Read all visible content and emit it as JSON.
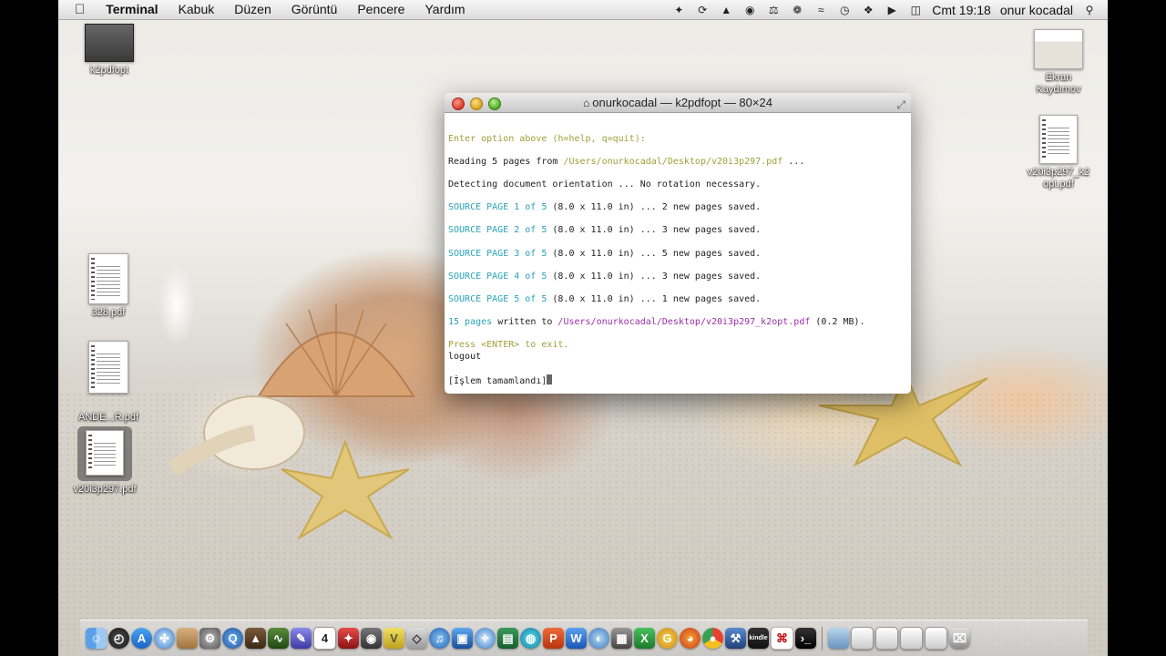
{
  "menubar": {
    "app_name": "Terminal",
    "items": [
      "Kabuk",
      "Düzen",
      "Görüntü",
      "Pencere",
      "Yardım"
    ],
    "clock": "Cmt 19:18",
    "user": "onur kocadal",
    "tray_icons": [
      "dropbox-icon",
      "sync-icon",
      "hat-icon",
      "disk-icon",
      "bank-icon",
      "gift-icon",
      "wifi-icon",
      "time-machine-icon",
      "bluetooth-icon",
      "volume-icon",
      "battery-icon"
    ]
  },
  "desktop_icons": {
    "k2pdfopt": "k2pdfopt",
    "ekran": "Ekran\nKaydımov",
    "v20_k2opt": "v20i3p297_k2\nopt.pdf",
    "pdf328": "328.pdf",
    "ande": "ANDE...R.pdf",
    "v20": "v20i3p297.pdf"
  },
  "terminal": {
    "title": "onurkocadal — k2pdfopt — 80×24",
    "lines": {
      "prompt": "Enter option above (h=help, q=quit):",
      "reading_pre": "Reading 5 pages from ",
      "reading_path": "/Users/onurkocadal/Desktop/v20i3p297.pdf",
      "reading_post": " ...",
      "detecting": "Detecting document orientation ... No rotation necessary.",
      "src1_a": "SOURCE PAGE 1 of 5",
      "src1_b": " (8.0 x 11.0 in) ... 2 new pages saved.",
      "src2_a": "SOURCE PAGE 2 of 5",
      "src2_b": " (8.0 x 11.0 in) ... 3 new pages saved.",
      "src3_a": "SOURCE PAGE 3 of 5",
      "src3_b": " (8.0 x 11.0 in) ... 5 new pages saved.",
      "src4_a": "SOURCE PAGE 4 of 5",
      "src4_b": " (8.0 x 11.0 in) ... 3 new pages saved.",
      "src5_a": "SOURCE PAGE 5 of 5",
      "src5_b": " (8.0 x 11.0 in) ... 1 new pages saved.",
      "written_a": "15 pages",
      "written_b": " written to ",
      "written_path": "/Users/onurkocadal/Desktop/v20i3p297_k2opt.pdf",
      "written_c": " (0.2 MB).",
      "press": "Press <ENTER> to exit.",
      "logout": "logout",
      "done": "[İşlem tamamlandı]"
    }
  },
  "dock": {
    "icons": [
      "finder-icon",
      "dashboard-icon",
      "app-store-icon",
      "safari-icon",
      "preview-icon",
      "system-preferences-icon",
      "quicktime-icon",
      "keynote-icon",
      "activity-monitor-icon",
      "pen-icon",
      "calendar-icon",
      "photo-booth-icon",
      "facetime-icon",
      "vlc-icon",
      "vectorworks-icon",
      "itunes-icon",
      "screen-icon",
      "safari-alt-icon",
      "iphoto-icon",
      "firefox-alt-icon",
      "powerpoint-icon",
      "word-icon",
      "maps-icon",
      "preferences-icon",
      "excel-icon",
      "chrome-alt-icon",
      "firefox-icon",
      "chrome-icon",
      "xcode-icon",
      "kindle-icon",
      "acrobat-icon",
      "terminal-icon",
      "folder-icon",
      "window-icon",
      "window-icon-2",
      "window-icon-3",
      "window-icon-4",
      "trash-icon"
    ],
    "calendar_day": "4",
    "kindle_label": "kindle",
    "word_letter": "W"
  },
  "colors": {
    "prompt": "#a0a03a",
    "cyan": "#2aa2b8",
    "purple": "#9a2fa8"
  }
}
